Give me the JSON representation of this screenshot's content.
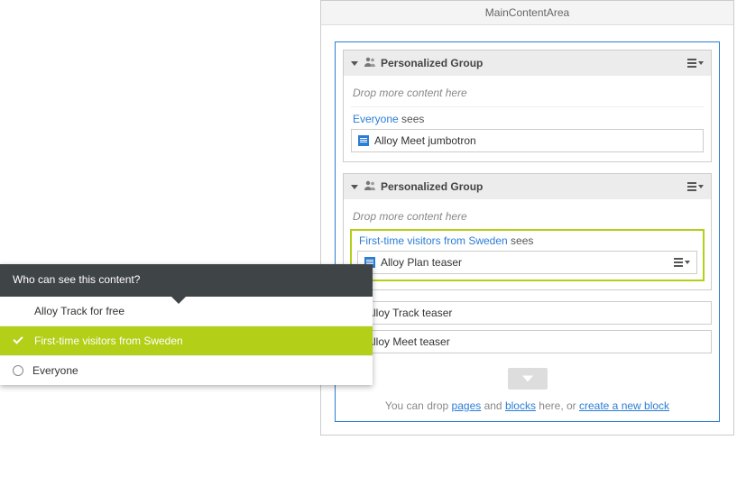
{
  "header": {
    "title": "MainContentArea"
  },
  "groups": [
    {
      "title": "Personalized Group",
      "drop_hint": "Drop more content here",
      "segment": {
        "audience": "Everyone",
        "sees": " sees",
        "items": [
          "Alloy Meet jumbotron"
        ]
      }
    },
    {
      "title": "Personalized Group",
      "drop_hint": "Drop more content here",
      "segment": {
        "audience": "First-time visitors from Sweden",
        "sees": " sees",
        "items": [
          "Alloy Plan teaser"
        ]
      }
    }
  ],
  "blocks": [
    "Alloy Track teaser",
    "Alloy Meet teaser"
  ],
  "dropzone": {
    "pre": "You can drop ",
    "pages": "pages",
    "mid": " and ",
    "blocks": "blocks",
    "post": " here, or ",
    "create": "create a new block"
  },
  "popover": {
    "title": "Who can see this content?",
    "options": [
      {
        "label": "Alloy Track for free"
      },
      {
        "label": "First-time visitors from Sweden"
      },
      {
        "label": "Everyone"
      }
    ]
  }
}
